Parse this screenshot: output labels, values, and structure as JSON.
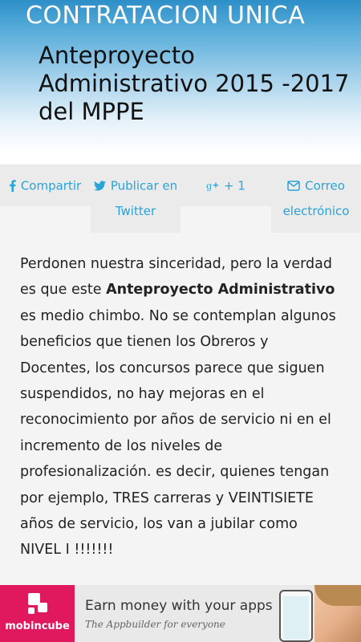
{
  "header": {
    "site_title": "CONTRATACION UNICA",
    "post_title": "Anteproyecto Administrativo 2015 -2017 del MPPE"
  },
  "share": {
    "facebook": {
      "icon": "facebook-icon",
      "line1": "Compartir"
    },
    "twitter": {
      "icon": "twitter-icon",
      "line1": "Publicar en",
      "line2": "Twitter"
    },
    "gplus": {
      "icon": "google-plus-icon",
      "line1": "+ 1"
    },
    "email": {
      "icon": "envelope-icon",
      "line1": "Correo",
      "line2": "electrónico"
    },
    "link_color": "#29a3d8"
  },
  "article": {
    "p1": "Perdonen nuestra sinceridad, pero la verdad es que este ",
    "bold": "Anteproyecto Administrativo",
    "p2": " es medio chimbo. No se contemplan algunos beneficios que tienen los Obreros y Docentes, los concursos parece que siguen suspendidos, no hay mejoras en el reconocimiento por años de servicio ni en el incremento de los niveles de profesionalización. es decir, quienes tengan por ejemplo, TRES carreras y VEINTISIETE años de servicio, los van a jubilar como NIVEL I !!!!!!!"
  },
  "ad": {
    "brand": "mobincube",
    "headline": "Earn money with your apps",
    "subline": "The Appbuilder for everyone",
    "brand_color": "#e0185e"
  }
}
